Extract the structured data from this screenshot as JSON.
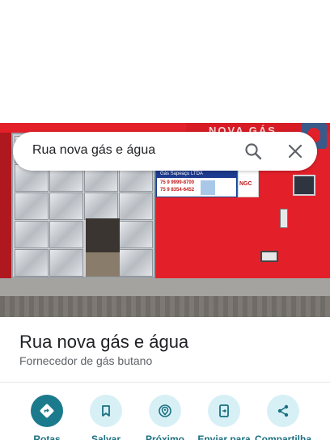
{
  "search": {
    "query": "Rua nova gás e água"
  },
  "place": {
    "name": "Rua nova gás e água",
    "category": "Fornecedor de gás butano"
  },
  "photo_sign": {
    "storefront": "NOVA GÁS",
    "poster_title": "Gás Sapeaçu LTDA",
    "phone_1": "75 9 9999-8700",
    "phone_2": "75 9 8354-6452",
    "brand": "NGC"
  },
  "actions": [
    {
      "label": "Rotas",
      "icon": "directions-icon"
    },
    {
      "label": "Salvar",
      "icon": "bookmark-icon"
    },
    {
      "label": "Próximo",
      "icon": "nearby-icon"
    },
    {
      "label": "Enviar para",
      "icon": "send-to-phone-icon"
    },
    {
      "label": "Compartilha",
      "icon": "share-icon"
    }
  ],
  "colors": {
    "accent": "#1b7a8c",
    "action_bg": "#d7f0f6",
    "label": "#1b6f80"
  }
}
